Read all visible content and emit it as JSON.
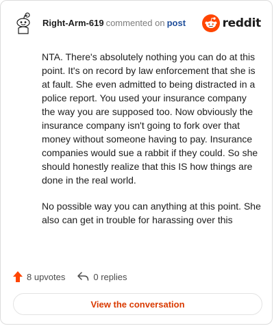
{
  "header": {
    "username": "Right-Arm-619",
    "commented_text": "commented on",
    "post_link": "post",
    "logo_text": "reddit",
    "logo_color": "#ff4500"
  },
  "comment": {
    "paragraphs": [
      "NTA. There's absolutely nothing you can do at this point. It's on record by law enforcement that she is at fault. She even admitted to being distracted in a police report. You used your insurance company the way you are supposed too. Now obviously the insurance company isn't going to fork over that money without someone having to pay. Insurance companies would sue a rabbit if they could. So she should honestly realize that this IS how things are done in the real world.",
      "No possible way you can anything at this point. She also can get in trouble for harassing over this"
    ]
  },
  "actions": {
    "upvotes": "8 upvotes",
    "replies": "0 replies",
    "upvote_icon": "upvote-arrow-icon",
    "reply_icon": "reply-arrow-icon"
  },
  "button": {
    "label": "View the conversation",
    "color": "#d93a00"
  }
}
